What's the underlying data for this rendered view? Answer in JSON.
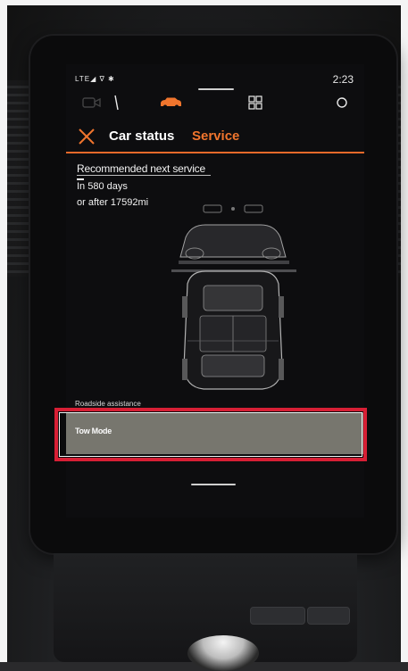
{
  "status_bar": {
    "signal": "LTE◢ ∇ ✱",
    "time": "2:23"
  },
  "app_row": {
    "icons": [
      "camera-icon",
      "car-icon",
      "grid-icon",
      "circle-icon"
    ],
    "accent_color": "#f0752d"
  },
  "header": {
    "tab_car_status": "Car status",
    "tab_service": "Service",
    "active_tab": "Service"
  },
  "service": {
    "title": "Recommended next service",
    "days": "In 580 days",
    "distance": "or after 17592mi"
  },
  "roadside": {
    "label": "Roadside assistance",
    "tow_mode": "Tow Mode"
  },
  "highlight_color": "#d71f35"
}
